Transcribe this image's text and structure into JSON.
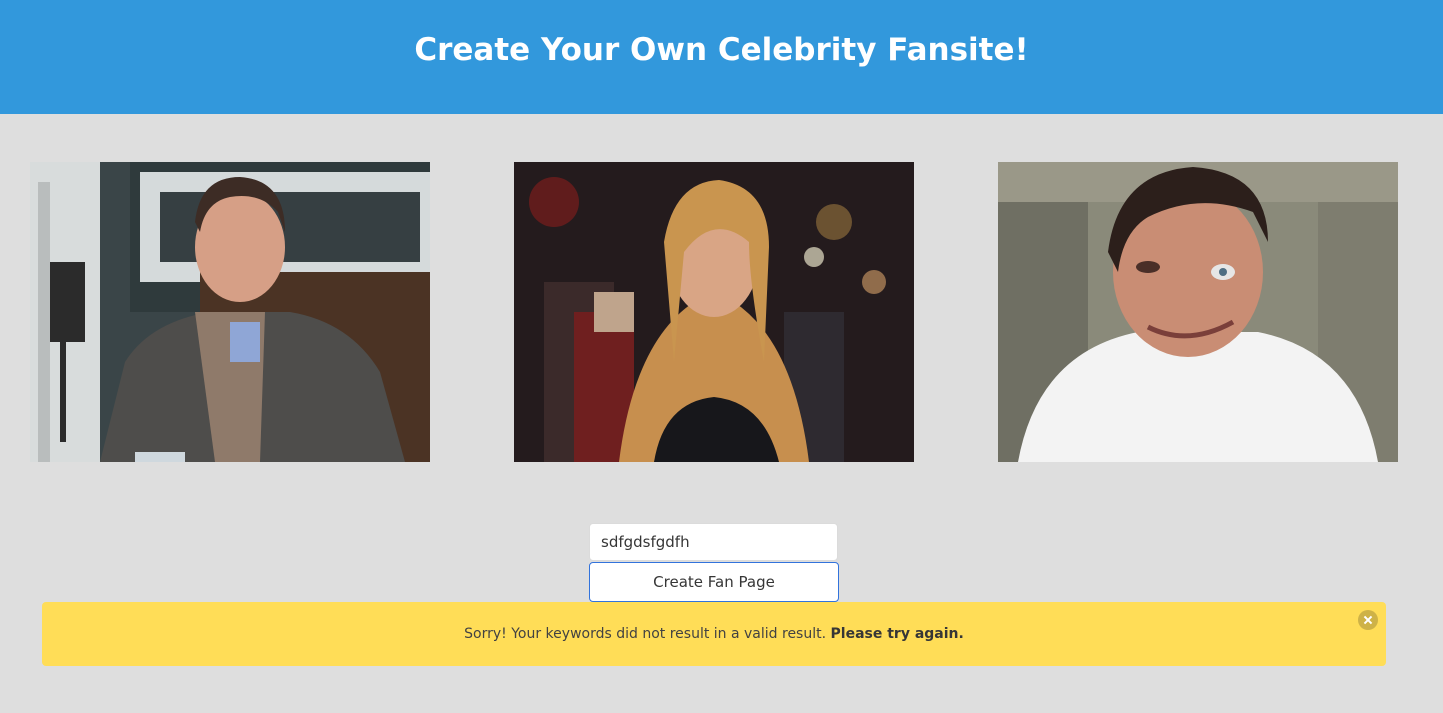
{
  "header": {
    "title": "Create Your Own Celebrity Fansite!"
  },
  "form": {
    "keyword_value": "sdfgdsfgdfh",
    "submit_label": "Create Fan Page"
  },
  "notification": {
    "message": "Sorry! Your keywords did not result in a valid result. ",
    "emphasis": "Please try again."
  },
  "colors": {
    "header_bg": "#3298dc",
    "page_bg": "#dedede",
    "warning_bg": "#ffdd57",
    "button_border": "#3273dc"
  }
}
